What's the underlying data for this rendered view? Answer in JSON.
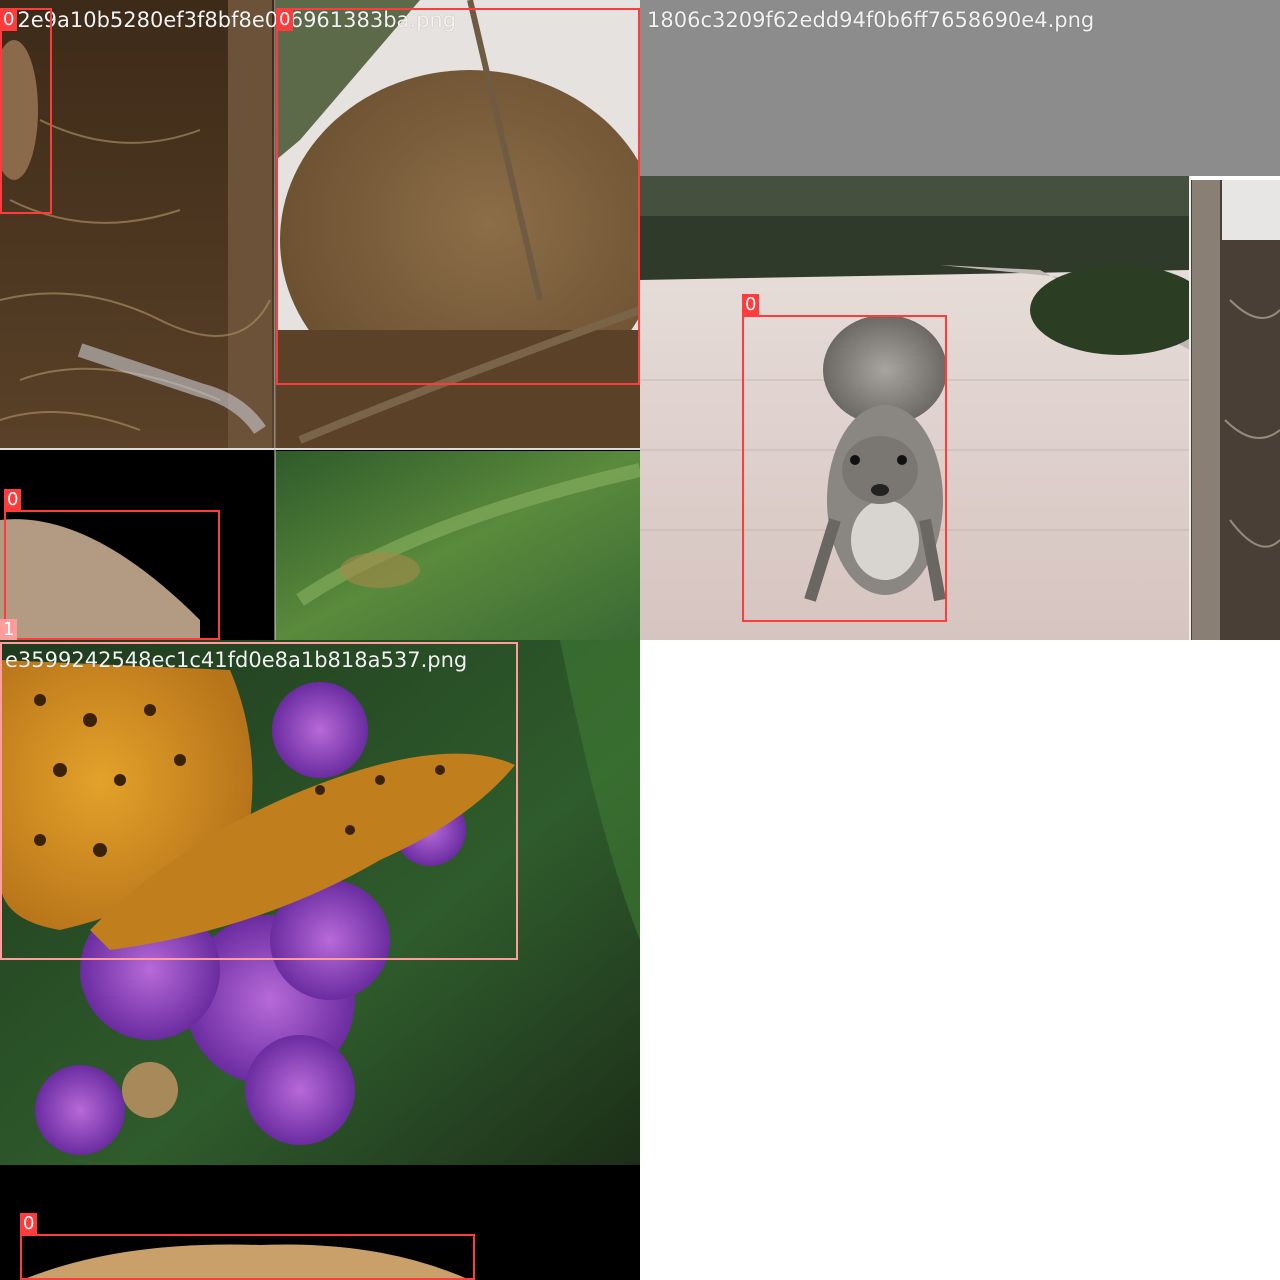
{
  "mosaic": {
    "tiles": [
      {
        "filename": "32e9a10b5280ef3f8bf8e0c6961383ba.png",
        "boxes": [
          {
            "class_label": "0"
          },
          {
            "class_label": "0"
          },
          {
            "class_label": "0"
          },
          {
            "class_label": "1"
          }
        ]
      },
      {
        "filename": "1806c3209f62edd94f0b6ff7658690e4.png",
        "boxes": [
          {
            "class_label": "0"
          }
        ]
      },
      {
        "filename": "e3599242548ec1c41fd0e8a1b818a537.png",
        "boxes": [
          {
            "class_label": "0"
          },
          {
            "class_label": "0"
          }
        ]
      }
    ]
  },
  "colors": {
    "box_class_0": "#ff3b3b",
    "box_class_1": "#ff9c9c",
    "padding_gray": "#8c8c8c",
    "canvas_background": "#ffffff"
  }
}
